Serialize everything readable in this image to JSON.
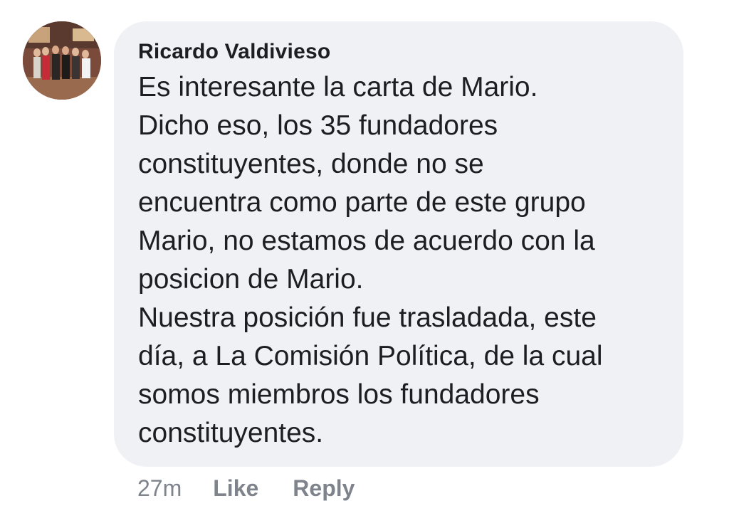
{
  "comment": {
    "author": "Ricardo Valdivieso",
    "text_lines": [
      "Es interesante la carta de Mario.",
      "Dicho eso, los 35 fundadores",
      "constituyentes, donde no se",
      "encuentra como parte de este grupo",
      "Mario, no estamos de acuerdo con la",
      "posicion de Mario.",
      "Nuestra posición fue trasladada, este",
      "día, a La Comisión Política, de la cual",
      "somos miembros los fundadores",
      "constituyentes."
    ],
    "timestamp": "27m",
    "like_label": "Like",
    "reply_label": "Reply"
  },
  "colors": {
    "bubble_background": "#f0f1f4",
    "text": "#1c1e21",
    "meta": "#7f848c"
  },
  "icons": {
    "avatar": "profile-photo"
  }
}
